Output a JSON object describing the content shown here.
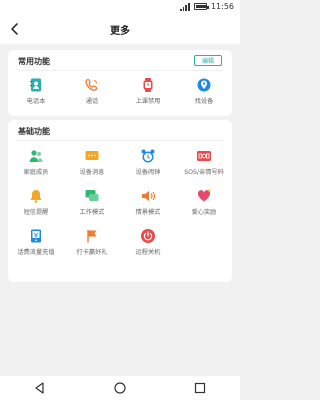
{
  "status_bar": {
    "time": "11:56"
  },
  "app_bar": {
    "title": "更多"
  },
  "common": {
    "title": "常用功能",
    "edit_label": "编辑",
    "items": [
      {
        "label": "电话本",
        "icon": "phonebook-icon"
      },
      {
        "label": "通话",
        "icon": "phone-icon"
      },
      {
        "label": "上课禁用",
        "icon": "watch-icon"
      },
      {
        "label": "找设备",
        "icon": "find-device-icon"
      }
    ]
  },
  "basic": {
    "title": "基础功能",
    "items": [
      {
        "label": "家庭成员",
        "icon": "family-icon"
      },
      {
        "label": "设备消息",
        "icon": "message-icon"
      },
      {
        "label": "设备闹钟",
        "icon": "alarm-icon"
      },
      {
        "label": "SOS/亲情号码",
        "icon": "sos-icon"
      },
      {
        "label": "短信提醒",
        "icon": "bell-icon"
      },
      {
        "label": "工作模式",
        "icon": "chat-icon"
      },
      {
        "label": "情景模式",
        "icon": "speaker-icon"
      },
      {
        "label": "爱心奖励",
        "icon": "heart-icon"
      },
      {
        "label": "话费流量充值",
        "icon": "topup-icon"
      },
      {
        "label": "打卡赢好礼",
        "icon": "flag-icon"
      },
      {
        "label": "远程关机",
        "icon": "power-icon"
      }
    ]
  },
  "colors": {
    "teal": "#27b0b0",
    "orange": "#f5a623",
    "blue": "#1e88e5",
    "red": "#e64a4a",
    "green": "#2eb872"
  }
}
